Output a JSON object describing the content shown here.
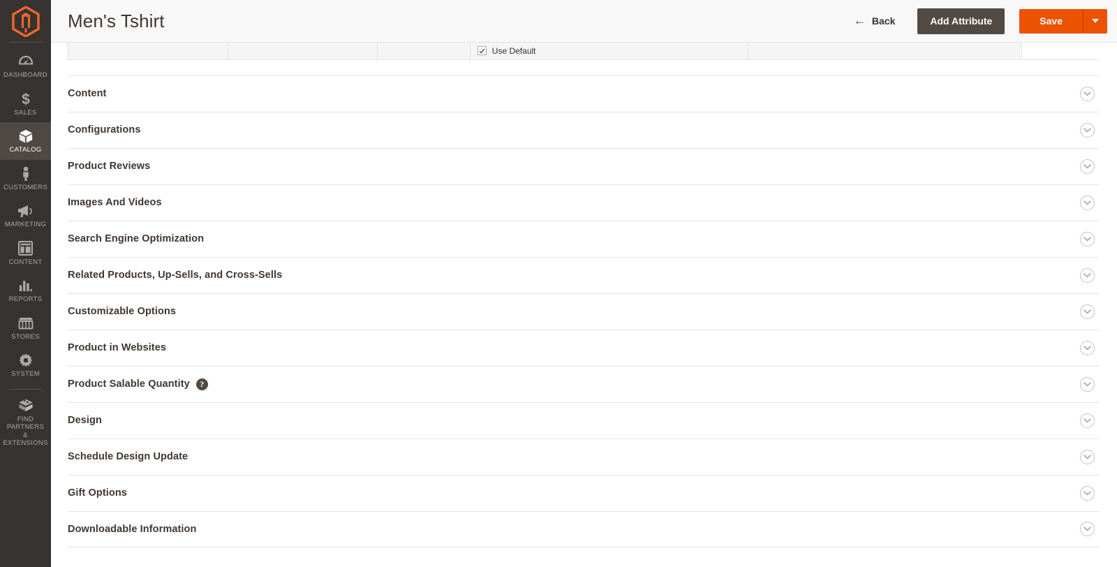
{
  "theme": {
    "sidebar_bg": "#373330",
    "sidebar_active_bg": "#4f4946",
    "accent_orange": "#eb5202",
    "dark_button": "#514943",
    "title_color": "#41362f",
    "border_color": "#e3e3e3"
  },
  "sidebar": {
    "logo_name": "magento-logo",
    "items": [
      {
        "label": "DASHBOARD",
        "icon": "dashboard-icon",
        "active": false,
        "divider_above": false
      },
      {
        "label": "SALES",
        "icon": "sales-dollar-icon",
        "active": false,
        "divider_above": false
      },
      {
        "label": "CATALOG",
        "icon": "catalog-box-icon",
        "active": true,
        "divider_above": false
      },
      {
        "label": "CUSTOMERS",
        "icon": "customers-person-icon",
        "active": false,
        "divider_above": false
      },
      {
        "label": "MARKETING",
        "icon": "marketing-megaphone-icon",
        "active": false,
        "divider_above": false
      },
      {
        "label": "CONTENT",
        "icon": "content-layout-icon",
        "active": false,
        "divider_above": false
      },
      {
        "label": "REPORTS",
        "icon": "reports-bar-chart-icon",
        "active": false,
        "divider_above": false
      },
      {
        "label": "STORES",
        "icon": "stores-shop-icon",
        "active": false,
        "divider_above": false
      },
      {
        "label": "SYSTEM",
        "icon": "system-gear-icon",
        "active": false,
        "divider_above": false
      },
      {
        "label": "FIND PARTNERS\n& EXTENSIONS",
        "icon": "partners-extensions-icon",
        "active": false,
        "divider_above": true
      }
    ]
  },
  "header": {
    "title": "Men's Tshirt",
    "back_label": "Back",
    "back_icon": "arrow-left-icon",
    "add_attribute_label": "Add Attribute",
    "save_label": "Save",
    "save_toggle_icon": "chevron-down-icon"
  },
  "attribute_table": {
    "use_default_label": "Use Default",
    "use_default_checked": true,
    "checkbox_icon": "checkmark-icon",
    "columns": [
      {
        "name": "col-1",
        "value": ""
      },
      {
        "name": "col-2",
        "value": ""
      },
      {
        "name": "col-3",
        "value": ""
      },
      {
        "name": "col-4",
        "value": ""
      },
      {
        "name": "col-5",
        "value": ""
      },
      {
        "name": "col-6",
        "value": ""
      }
    ]
  },
  "sections": [
    {
      "title": "Content",
      "name": "section-content",
      "help": false,
      "collapse_icon": "chevron-down-circle-icon"
    },
    {
      "title": "Configurations",
      "name": "section-configurations",
      "help": false,
      "collapse_icon": "chevron-down-circle-icon"
    },
    {
      "title": "Product Reviews",
      "name": "section-product-reviews",
      "help": false,
      "collapse_icon": "chevron-down-circle-icon"
    },
    {
      "title": "Images And Videos",
      "name": "section-images-and-videos",
      "help": false,
      "collapse_icon": "chevron-down-circle-icon"
    },
    {
      "title": "Search Engine Optimization",
      "name": "section-search-engine-optimization",
      "help": false,
      "collapse_icon": "chevron-down-circle-icon"
    },
    {
      "title": "Related Products, Up-Sells, and Cross-Sells",
      "name": "section-related-products",
      "help": false,
      "collapse_icon": "chevron-down-circle-icon"
    },
    {
      "title": "Customizable Options",
      "name": "section-customizable-options",
      "help": false,
      "collapse_icon": "chevron-down-circle-icon"
    },
    {
      "title": "Product in Websites",
      "name": "section-product-in-websites",
      "help": false,
      "collapse_icon": "chevron-down-circle-icon"
    },
    {
      "title": "Product Salable Quantity",
      "name": "section-product-salable-quantity",
      "help": true,
      "help_icon": "help-question-icon",
      "help_glyph": "?",
      "collapse_icon": "chevron-down-circle-icon"
    },
    {
      "title": "Design",
      "name": "section-design",
      "help": false,
      "collapse_icon": "chevron-down-circle-icon"
    },
    {
      "title": "Schedule Design Update",
      "name": "section-schedule-design-update",
      "help": false,
      "collapse_icon": "chevron-down-circle-icon"
    },
    {
      "title": "Gift Options",
      "name": "section-gift-options",
      "help": false,
      "collapse_icon": "chevron-down-circle-icon"
    },
    {
      "title": "Downloadable Information",
      "name": "section-downloadable-information",
      "help": false,
      "collapse_icon": "chevron-down-circle-icon"
    }
  ]
}
